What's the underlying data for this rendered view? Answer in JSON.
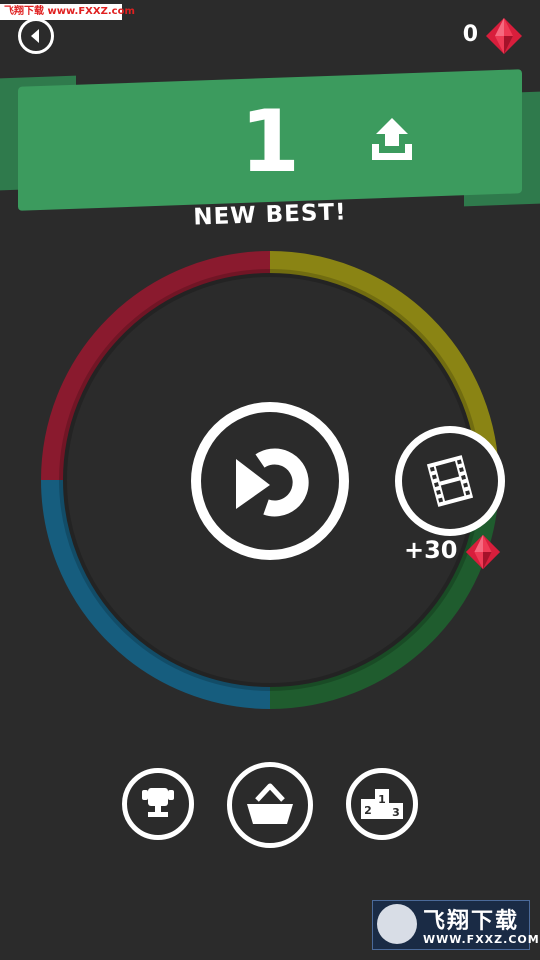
{
  "watermark_top": "飞翔下载 www.FXXZ.com",
  "header": {
    "gem_count": "0",
    "gem_color": "#d81e3c"
  },
  "result": {
    "score": "1",
    "subtitle": "NEW BEST!"
  },
  "ring": {
    "colors": [
      "#8a1a2e",
      "#8a8414",
      "#1f5c2e",
      "#165d7e"
    ]
  },
  "video_reward": {
    "label": "+30",
    "icon": "film-icon"
  },
  "bottom_buttons": [
    {
      "name": "trophy-button",
      "icon": "trophy-icon"
    },
    {
      "name": "shop-button",
      "icon": "basket-icon"
    },
    {
      "name": "leaderboard-button",
      "icon": "podium-icon",
      "places": [
        "1",
        "2",
        "3"
      ]
    }
  ],
  "watermark_bottom": {
    "title": "飞翔下载",
    "url": "WWW.FXXZ.COM"
  }
}
